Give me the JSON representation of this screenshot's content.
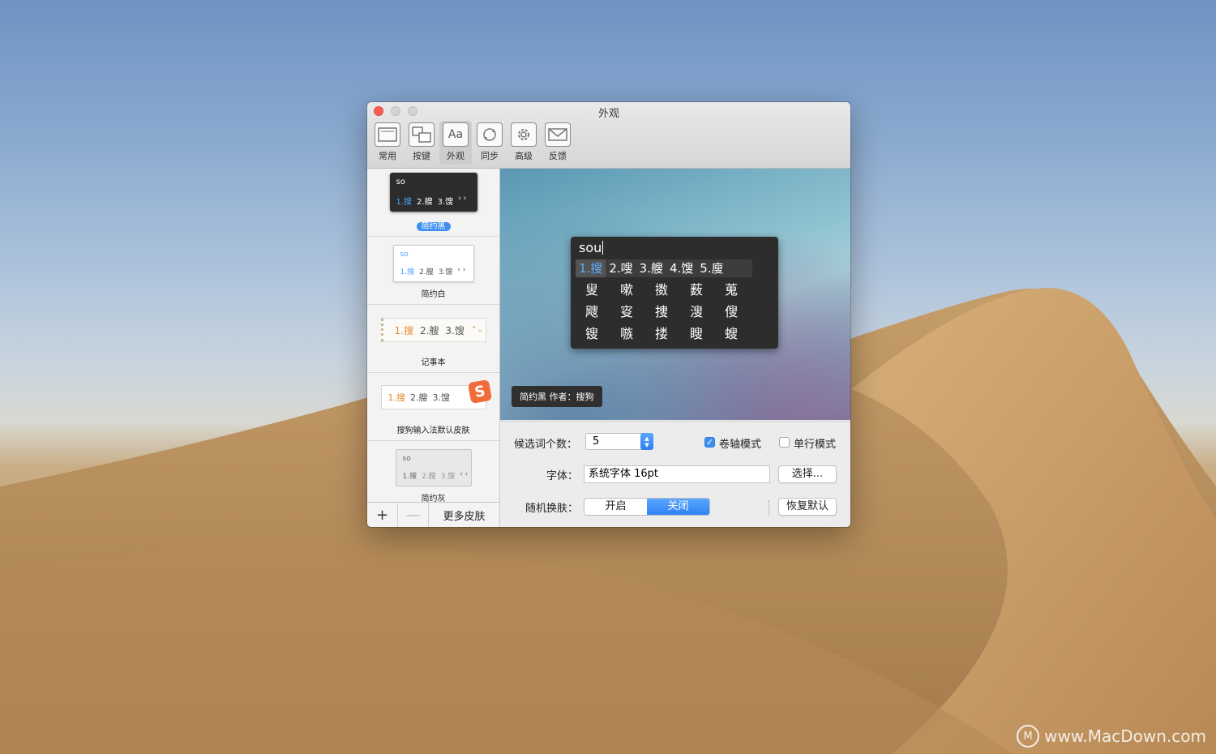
{
  "window": {
    "title": "外观"
  },
  "toolbar": {
    "items": [
      {
        "label": "常用",
        "icon": "general-icon"
      },
      {
        "label": "按键",
        "icon": "keys-icon"
      },
      {
        "label": "外观",
        "icon": "appearance-icon",
        "icon_text": "Aa",
        "active": true
      },
      {
        "label": "同步",
        "icon": "sync-icon"
      },
      {
        "label": "高级",
        "icon": "gear-icon"
      },
      {
        "label": "反馈",
        "icon": "mail-icon"
      }
    ]
  },
  "skins": {
    "items": [
      {
        "name": "简约黑",
        "selected": true,
        "input": "so",
        "c1": "1.搜",
        "c2": "2.艘",
        "c3": "3.馊"
      },
      {
        "name": "简约白",
        "input": "so",
        "c1": "1.搜",
        "c2": "2.艘",
        "c3": "3.馊"
      },
      {
        "name": "记事本",
        "c1": "1.搜",
        "c2": "2.艘",
        "c3": "3.馊"
      },
      {
        "name": "搜狗输入法默认皮肤",
        "c1": "1.搜",
        "c2": "2.艘",
        "c3": "3.馊",
        "logo": "S"
      },
      {
        "name": "简约灰",
        "input": "so",
        "c1": "1.搜",
        "c2": "2.艘",
        "c3": "3.馊"
      }
    ],
    "add_label": "+",
    "remove_label": "—",
    "more_label": "更多皮肤"
  },
  "preview": {
    "input": "sou",
    "row1": [
      "1.搜",
      "2.嗖",
      "3.艘",
      "4.馊",
      "5.廋"
    ],
    "grid": [
      "叟",
      "嗽",
      "擞",
      "薮",
      "蒐",
      "飕",
      "叜",
      "捜",
      "溲",
      "傁",
      "锼",
      "嗾",
      "搂",
      "瞍",
      "螋"
    ],
    "caption": "简约黑  作者：搜狗"
  },
  "settings": {
    "count_label": "候选词个数：",
    "count_value": "5",
    "scroll_mode_label": "卷轴模式",
    "scroll_mode_checked": true,
    "single_line_label": "单行模式",
    "single_line_checked": false,
    "font_label": "字体：",
    "font_value": "系统字体   16pt",
    "choose_button": "选择...",
    "random_label": "随机换肤：",
    "random_on": "开启",
    "random_off": "关闭",
    "random_selected": "关闭",
    "reset_button": "恢复默认"
  },
  "watermark": {
    "text": "www.MacDown.com",
    "logo": "M"
  },
  "colors": {
    "accent": "#3d8ff0",
    "close": "#fc5d57",
    "ime_bg": "#2d2d2d",
    "highlight": "#5aaeff"
  }
}
